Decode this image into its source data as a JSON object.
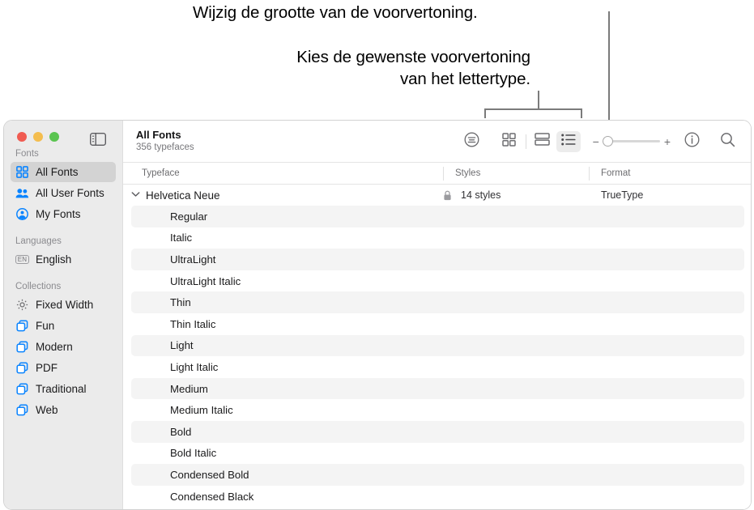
{
  "annotations": {
    "callout_1": "Wijzig de grootte van de voorvertoning.",
    "callout_2_line1": "Kies de gewenste voorvertoning",
    "callout_2_line2": "van het lettertype."
  },
  "window": {
    "traffic_lights": [
      "close",
      "minimize",
      "zoom"
    ],
    "sidebar_toggle": "sidebar-toggle-icon"
  },
  "sidebar": {
    "groups": [
      {
        "label": "Fonts",
        "items": [
          {
            "label": "All Fonts",
            "icon": "grid-squares-icon",
            "selected": true
          },
          {
            "label": "All User Fonts",
            "icon": "two-people-icon",
            "selected": false
          },
          {
            "label": "My Fonts",
            "icon": "person-circle-icon",
            "selected": false
          }
        ]
      },
      {
        "label": "Languages",
        "items": [
          {
            "label": "English",
            "icon": "en-badge-icon",
            "selected": false
          }
        ]
      },
      {
        "label": "Collections",
        "items": [
          {
            "label": "Fixed Width",
            "icon": "gear-icon",
            "selected": false
          },
          {
            "label": "Fun",
            "icon": "collection-stack-icon",
            "selected": false
          },
          {
            "label": "Modern",
            "icon": "collection-stack-icon",
            "selected": false
          },
          {
            "label": "PDF",
            "icon": "collection-stack-icon",
            "selected": false
          },
          {
            "label": "Traditional",
            "icon": "collection-stack-icon",
            "selected": false
          },
          {
            "label": "Web",
            "icon": "collection-stack-icon",
            "selected": false
          }
        ]
      }
    ]
  },
  "toolbar": {
    "title": "All Fonts",
    "subtitle": "356 typefaces",
    "sample_text_icon": "lines-in-circle-icon",
    "view_grid_icon": "grid-view-icon",
    "view_split_icon": "split-view-icon",
    "view_list_icon": "list-view-icon",
    "active_view": "list",
    "slider": {
      "minus": "−",
      "plus": "+",
      "value": 0
    },
    "info_icon": "info-circle-icon",
    "search_icon": "search-icon"
  },
  "table": {
    "columns": [
      "Typeface",
      "Styles",
      "Format"
    ],
    "family": {
      "name": "Helvetica Neue",
      "locked": true,
      "lock_icon": "lock-icon",
      "styles": "14 styles",
      "format": "TrueType",
      "expanded": true
    },
    "styles": [
      "Regular",
      "Italic",
      "UltraLight",
      "UltraLight Italic",
      "Thin",
      "Thin Italic",
      "Light",
      "Light Italic",
      "Medium",
      "Medium Italic",
      "Bold",
      "Bold Italic",
      "Condensed Bold",
      "Condensed Black"
    ]
  },
  "colors": {
    "accent_blue": "#0a84ff",
    "sidebar_bg": "#ebebeb",
    "selected_row": "#d3d3d3",
    "zebra_row": "#f4f4f4",
    "traffic_red": "#f05b51",
    "traffic_yellow": "#f4bd4e",
    "traffic_green": "#5ac450"
  }
}
